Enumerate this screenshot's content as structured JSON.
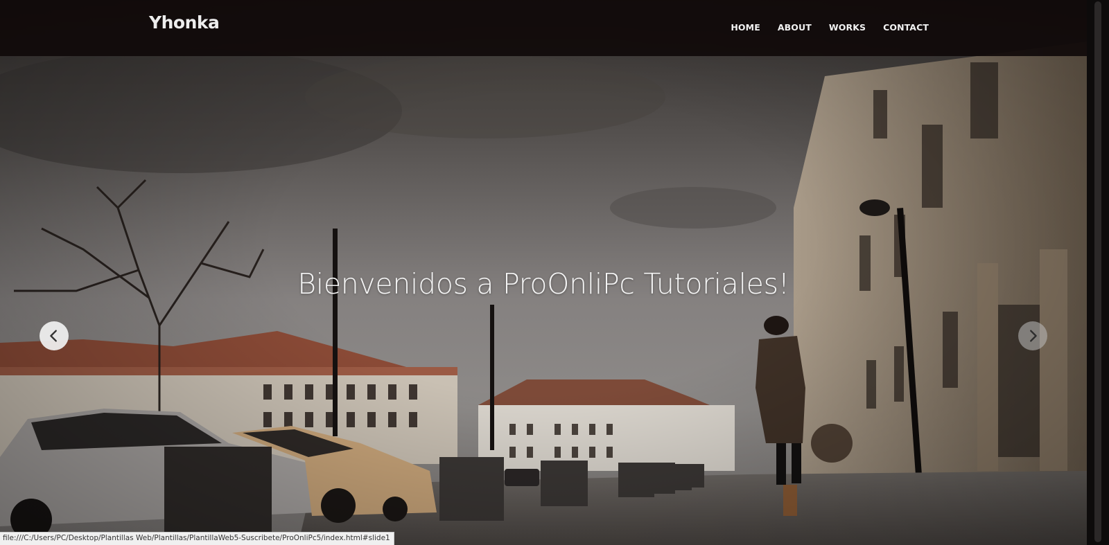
{
  "navbar": {
    "brand": "Yhonka",
    "links": [
      {
        "label": "HOME"
      },
      {
        "label": "ABOUT"
      },
      {
        "label": "WORKS"
      },
      {
        "label": "CONTACT"
      }
    ]
  },
  "slider": {
    "caption": "Bienvenidos a ProOnliPc Tutoriales!",
    "prev_icon": "chevron-left-icon",
    "next_icon": "chevron-right-icon"
  },
  "status_bar": {
    "url": "file:///C:/Users/PC/Desktop/Plantillas Web/Plantillas/PlantillaWeb5-Suscribete/ProOnliPc5/index.html#slide1"
  },
  "colors": {
    "navbar_bg": "#100a0a",
    "text_light": "#f2f2f2"
  }
}
